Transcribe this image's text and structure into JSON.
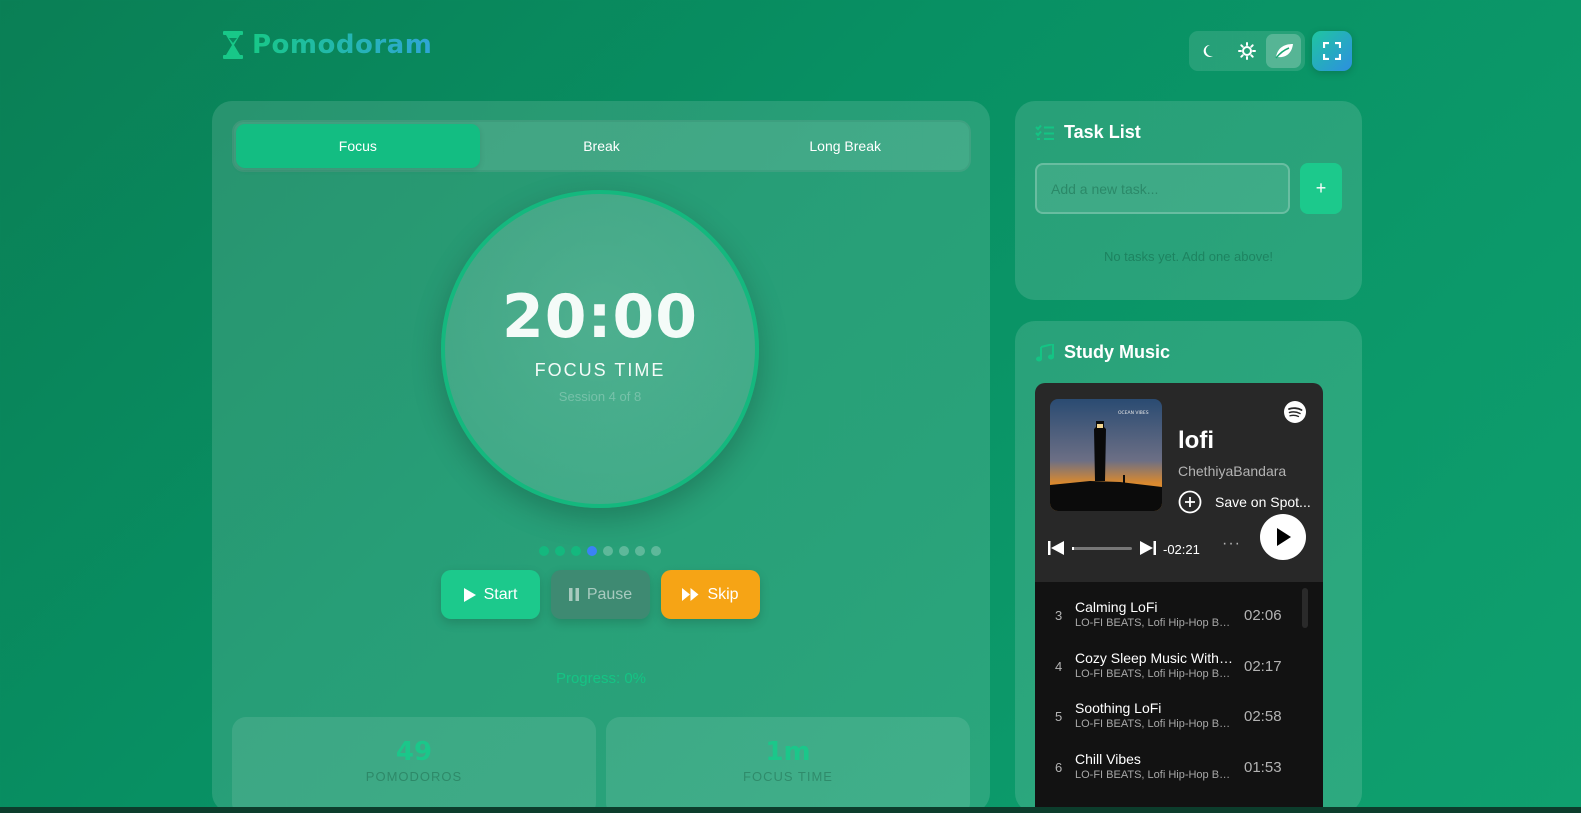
{
  "app": {
    "name": "Pomodoram"
  },
  "header": {
    "theme_buttons": [
      {
        "icon": "moon-icon",
        "active": false
      },
      {
        "icon": "sun-icon",
        "active": false
      },
      {
        "icon": "leaf-icon",
        "active": true
      }
    ],
    "fullscreen_icon": "fullscreen-icon"
  },
  "timer": {
    "tabs": [
      {
        "label": "Focus",
        "active": true
      },
      {
        "label": "Break",
        "active": false
      },
      {
        "label": "Long Break",
        "active": false
      }
    ],
    "time": "20:00",
    "mode_label": "FOCUS TIME",
    "session_text": "Session 4 of 8",
    "session_dots": {
      "total": 8,
      "completed": 3,
      "current": 4
    },
    "controls": {
      "start": "Start",
      "pause": "Pause",
      "skip": "Skip"
    },
    "progress_text": "Progress: 0%",
    "stats": [
      {
        "value": "49",
        "label": "POMODOROS"
      },
      {
        "value": "1m",
        "label": "FOCUS TIME"
      }
    ]
  },
  "tasks": {
    "title": "Task List",
    "input_placeholder": "Add a new task...",
    "add_label": "+",
    "empty_text": "No tasks yet. Add one above!"
  },
  "music": {
    "title": "Study Music",
    "playlist_title": "lofi",
    "playlist_owner": "ChethiyaBandara",
    "save_label": "Save on Spot...",
    "remaining": "-02:21",
    "more": "···",
    "album_text_top": "OCEAN VIBES",
    "tracks": [
      {
        "num": "3",
        "name": "Calming LoFi",
        "artist": "LO-FI BEATS, Lofi Hip-Hop Beats",
        "duration": "02:06"
      },
      {
        "num": "4",
        "name": "Cozy Sleep Music With Rain",
        "artist": "LO-FI BEATS, Lofi Hip-Hop Beats",
        "duration": "02:17"
      },
      {
        "num": "5",
        "name": "Soothing LoFi",
        "artist": "LO-FI BEATS, Lofi Hip-Hop Beats",
        "duration": "02:58"
      },
      {
        "num": "6",
        "name": "Chill Vibes",
        "artist": "LO-FI BEATS, Lofi Hip-Hop Beats",
        "duration": "01:53"
      }
    ]
  },
  "colors": {
    "accent": "#1cc98c",
    "skip": "#f6a415",
    "current_dot": "#3b82f6",
    "spotify_bg": "#282828"
  }
}
